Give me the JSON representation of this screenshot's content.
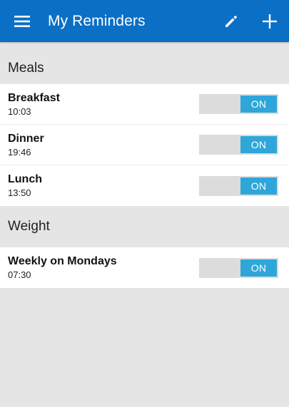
{
  "appbar": {
    "title": "My Reminders",
    "menu_icon": "menu-icon",
    "edit_icon": "pencil-icon",
    "add_icon": "plus-icon",
    "color": "#0b6fc6"
  },
  "sections": [
    {
      "title": "Meals",
      "items": [
        {
          "label": "Breakfast",
          "time": "10:03",
          "toggle": "ON"
        },
        {
          "label": "Dinner",
          "time": "19:46",
          "toggle": "ON"
        },
        {
          "label": "Lunch",
          "time": "13:50",
          "toggle": "ON"
        }
      ]
    },
    {
      "title": "Weight",
      "items": [
        {
          "label": "Weekly on Mondays",
          "time": "07:30",
          "toggle": "ON"
        }
      ]
    }
  ],
  "toggle_color": "#2fa6da"
}
